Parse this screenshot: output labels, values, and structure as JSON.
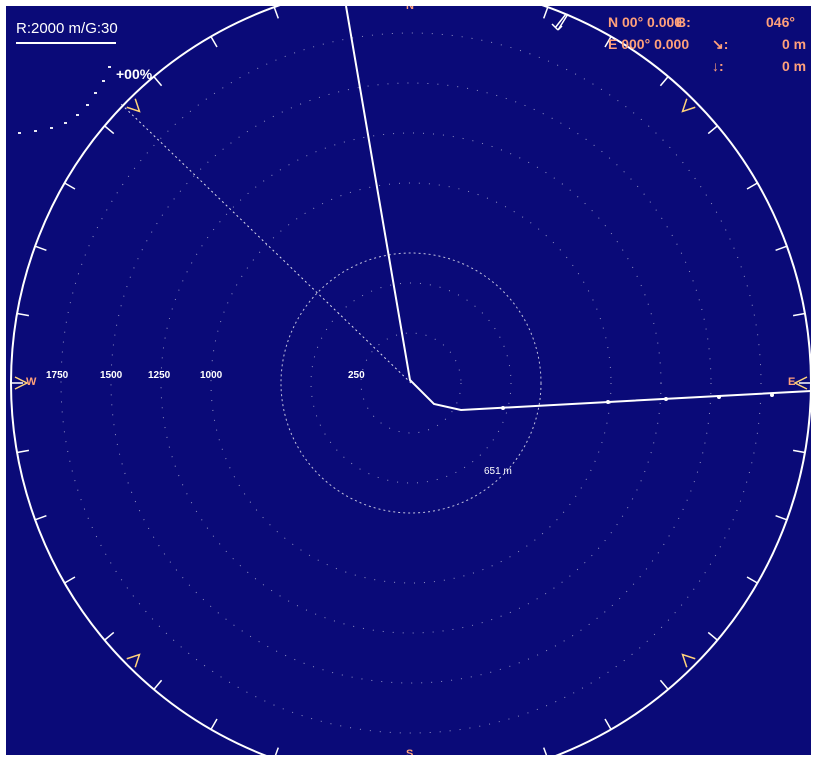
{
  "display": {
    "range_label": "R:2000 m/G:30",
    "gain_offset": "+00%",
    "latitude": "N  00° 0.000",
    "longitude": "E 000° 0.000",
    "bearing_label": "B:",
    "bearing_value": "046°",
    "distance_1_value": "0 m",
    "distance_2_value": "0 m",
    "scale_labels": [
      "1750",
      "1500",
      "1250",
      "1000",
      "250"
    ],
    "target_distance": "651 m",
    "cardinals": {
      "west": "W",
      "east": "E",
      "north": "N",
      "south": "S"
    }
  },
  "colors": {
    "background": "#0a0a78",
    "track": "#ffffff",
    "hud_text": "#ffa07a",
    "markers": "#ffd27a"
  },
  "icons": {
    "range_underline": "scale-bar",
    "distance_1": "diagonal-arrow-icon",
    "distance_2": "down-arrow-icon",
    "heading": "heading-arrow-icon"
  }
}
